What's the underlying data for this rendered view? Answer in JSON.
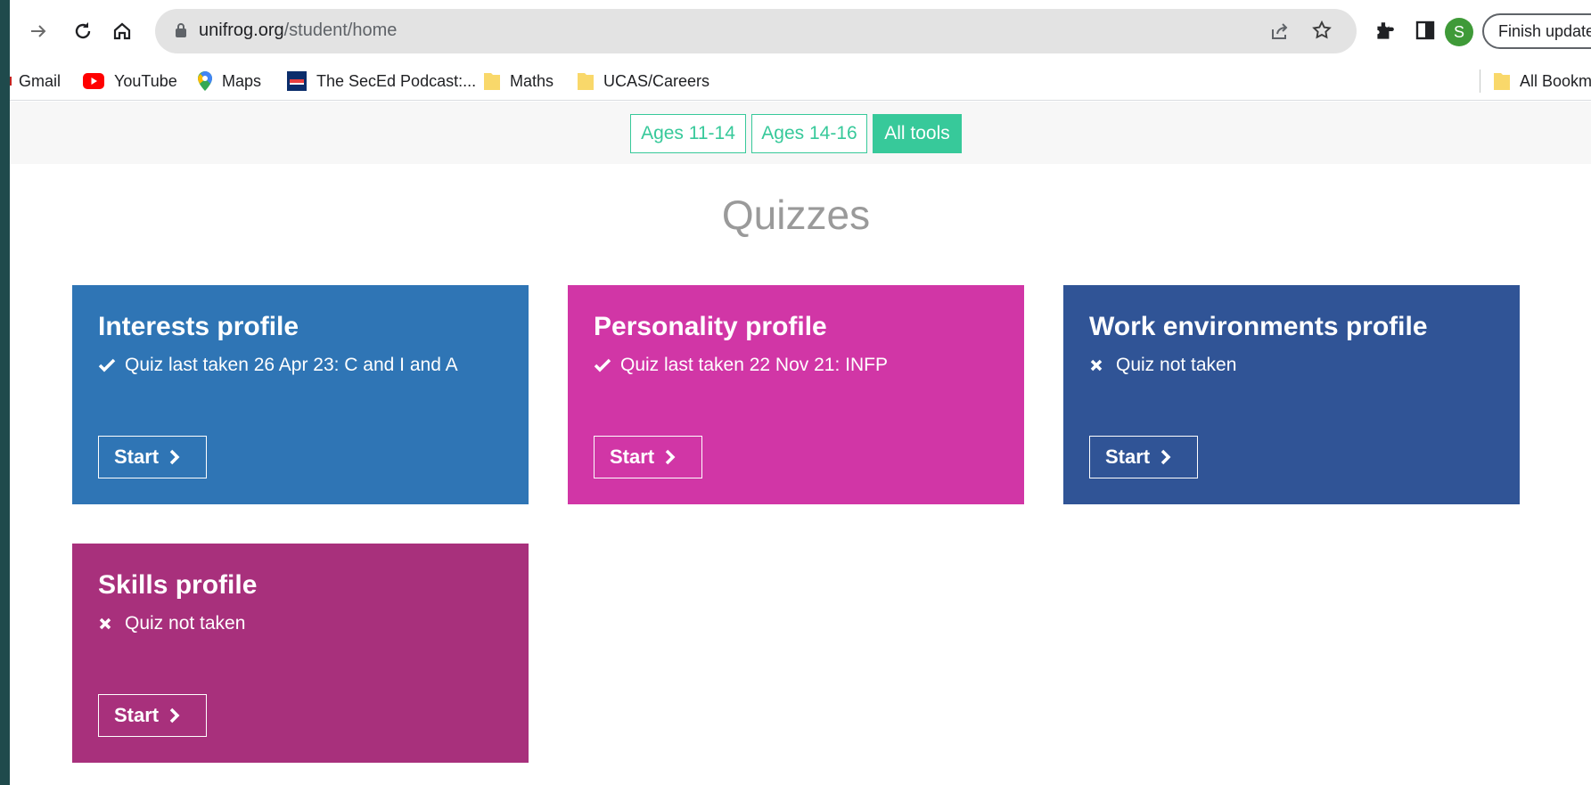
{
  "browser": {
    "url_domain": "unifrog.org",
    "url_path": "/student/home",
    "profile_initial": "S",
    "finish_update_label": "Finish update",
    "bookmarks": [
      {
        "label": "Gmail",
        "icon": "gmail-icon"
      },
      {
        "label": "YouTube",
        "icon": "youtube-icon"
      },
      {
        "label": "Maps",
        "icon": "maps-icon"
      },
      {
        "label": "The SecEd Podcast:...",
        "icon": "seced-icon"
      },
      {
        "label": "Maths",
        "icon": "folder-icon"
      },
      {
        "label": "UCAS/Careers",
        "icon": "folder-icon"
      }
    ],
    "all_bookmarks_label": "All Bookmarks"
  },
  "filters": [
    {
      "label": "Ages 11-14",
      "active": false
    },
    {
      "label": "Ages 14-16",
      "active": false
    },
    {
      "label": "All tools",
      "active": true
    }
  ],
  "page": {
    "heading": "Quizzes"
  },
  "quizzes": [
    {
      "title": "Interests profile",
      "status": "Quiz last taken 26 Apr 23: C and I and A",
      "taken": true,
      "color": "#2f75b5",
      "button": "Start"
    },
    {
      "title": "Personality profile",
      "status": "Quiz last taken 22 Nov 21: INFP",
      "taken": true,
      "color": "#d136a6",
      "button": "Start"
    },
    {
      "title": "Work environments profile",
      "status": "Quiz not taken",
      "taken": false,
      "color": "#305496",
      "button": "Start"
    },
    {
      "title": "Skills profile",
      "status": "Quiz not taken",
      "taken": false,
      "color": "#a8307c",
      "button": "Start"
    }
  ],
  "colors": {
    "accent": "#37c99a",
    "avatar": "#3f9a38"
  }
}
